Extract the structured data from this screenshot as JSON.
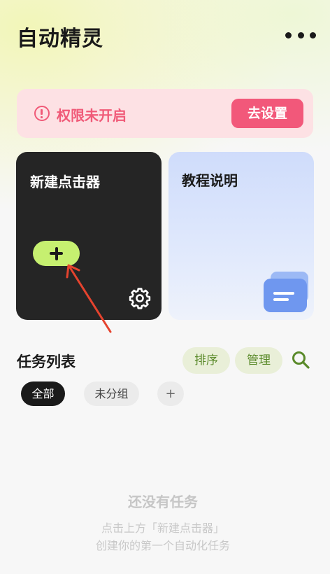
{
  "header": {
    "title": "自动精灵",
    "more_icon": "more-horizontal-icon"
  },
  "permission_banner": {
    "icon": "alert-circle-icon",
    "text": "权限未开启",
    "button_label": "去设置",
    "color": "#f05a78"
  },
  "cards": {
    "new_clicker": {
      "title": "新建点击器",
      "add_icon": "plus-icon",
      "settings_icon": "gear-icon",
      "accent": "#c6f070"
    },
    "tutorial": {
      "title": "教程说明",
      "icon": "document-icon"
    }
  },
  "task_list": {
    "title": "任务列表",
    "sort_label": "排序",
    "manage_label": "管理",
    "search_icon": "search-icon",
    "chips": [
      {
        "label": "全部",
        "selected": true
      },
      {
        "label": "未分组",
        "selected": false
      },
      {
        "label": "+",
        "selected": false
      }
    ]
  },
  "empty_state": {
    "title": "还没有任务",
    "line1": "点击上方「新建点击器」",
    "line2": "创建你的第一个自动化任务"
  }
}
